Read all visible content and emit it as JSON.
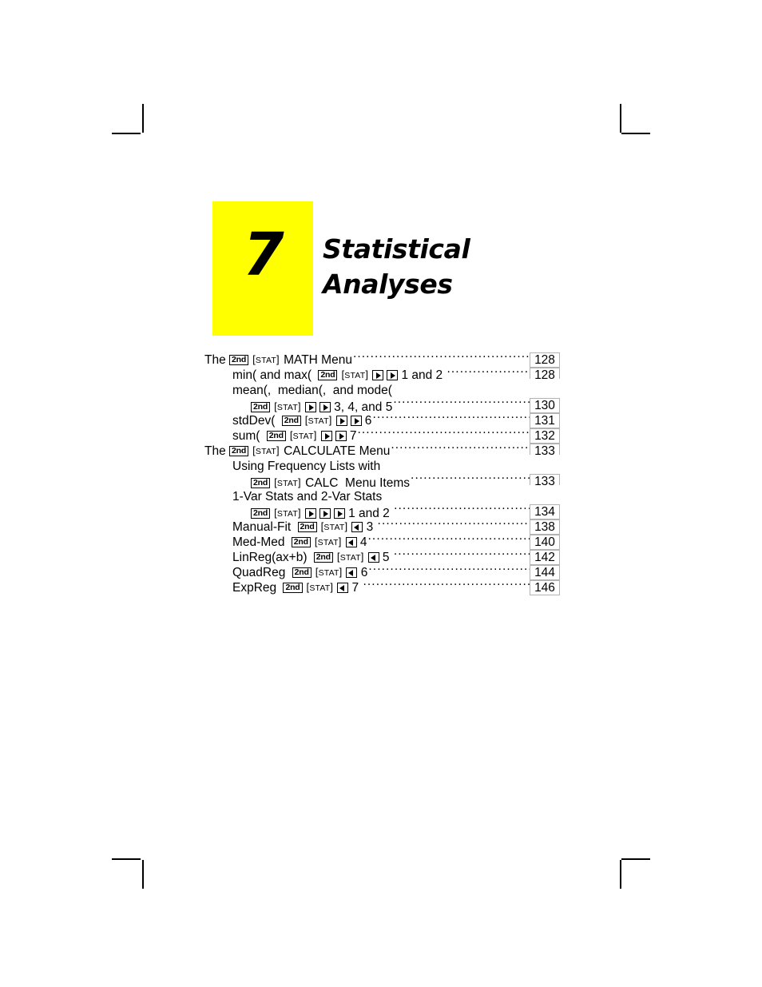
{
  "chapter": {
    "number": "7",
    "title_lines": [
      "Statistical",
      "Analyses"
    ],
    "accent_color": "#ffff00"
  },
  "toc": {
    "rows": [
      {
        "level": 1,
        "page": "128",
        "parts": [
          {
            "t": "text",
            "v": "The "
          },
          {
            "t": "key2nd",
            "v": "2nd"
          },
          {
            "t": "sp"
          },
          {
            "t": "keybrk",
            "v": "STAT"
          },
          {
            "t": "text",
            "v": " MATH Menu"
          }
        ]
      },
      {
        "level": 2,
        "page": "128",
        "parts": [
          {
            "t": "text",
            "v": "min( and max( "
          },
          {
            "t": "sp"
          },
          {
            "t": "key2nd",
            "v": "2nd"
          },
          {
            "t": "sp"
          },
          {
            "t": "keybrk",
            "v": "STAT"
          },
          {
            "t": "sp"
          },
          {
            "t": "keyright"
          },
          {
            "t": "sp"
          },
          {
            "t": "keyright"
          },
          {
            "t": "text",
            "v": " 1 and 2 "
          }
        ]
      },
      {
        "level": 2,
        "page": "",
        "nopage": true,
        "parts": [
          {
            "t": "text",
            "v": "mean(,  median(,  and mode("
          }
        ]
      },
      {
        "level": 3,
        "page": "130",
        "parts": [
          {
            "t": "key2nd",
            "v": "2nd"
          },
          {
            "t": "sp"
          },
          {
            "t": "keybrk",
            "v": "STAT"
          },
          {
            "t": "sp"
          },
          {
            "t": "keyright"
          },
          {
            "t": "sp"
          },
          {
            "t": "keyright"
          },
          {
            "t": "text",
            "v": " 3, 4, and 5"
          }
        ]
      },
      {
        "level": 2,
        "page": "131",
        "parts": [
          {
            "t": "text",
            "v": "stdDev( "
          },
          {
            "t": "sp"
          },
          {
            "t": "key2nd",
            "v": "2nd"
          },
          {
            "t": "sp"
          },
          {
            "t": "keybrk",
            "v": "STAT"
          },
          {
            "t": "sp"
          },
          {
            "t": "keyright"
          },
          {
            "t": "sp"
          },
          {
            "t": "keyright"
          },
          {
            "t": "text",
            "v": " 6"
          }
        ]
      },
      {
        "level": 2,
        "page": "132",
        "parts": [
          {
            "t": "text",
            "v": "sum( "
          },
          {
            "t": "sp"
          },
          {
            "t": "key2nd",
            "v": "2nd"
          },
          {
            "t": "sp"
          },
          {
            "t": "keybrk",
            "v": "STAT"
          },
          {
            "t": "sp"
          },
          {
            "t": "keyright"
          },
          {
            "t": "sp"
          },
          {
            "t": "keyright"
          },
          {
            "t": "text",
            "v": " 7"
          }
        ]
      },
      {
        "level": 1,
        "page": "133",
        "parts": [
          {
            "t": "text",
            "v": "The "
          },
          {
            "t": "key2nd",
            "v": "2nd"
          },
          {
            "t": "sp"
          },
          {
            "t": "keybrk",
            "v": "STAT"
          },
          {
            "t": "text",
            "v": " CALCULATE Menu"
          }
        ]
      },
      {
        "level": 2,
        "page": "",
        "nopage": true,
        "parts": [
          {
            "t": "text",
            "v": "Using Frequency Lists with"
          }
        ]
      },
      {
        "level": 3,
        "page": "133",
        "parts": [
          {
            "t": "key2nd",
            "v": "2nd"
          },
          {
            "t": "sp"
          },
          {
            "t": "keybrk",
            "v": "STAT"
          },
          {
            "t": "text",
            "v": " CALC  Menu Items"
          }
        ]
      },
      {
        "level": 2,
        "page": "",
        "nopage": true,
        "parts": [
          {
            "t": "text",
            "v": "1-Var Stats and 2-Var Stats"
          }
        ]
      },
      {
        "level": 3,
        "page": "134",
        "parts": [
          {
            "t": "key2nd",
            "v": "2nd"
          },
          {
            "t": "sp"
          },
          {
            "t": "keybrk",
            "v": "STAT"
          },
          {
            "t": "sp"
          },
          {
            "t": "keyright"
          },
          {
            "t": "sp"
          },
          {
            "t": "keyright"
          },
          {
            "t": "sp"
          },
          {
            "t": "keyright"
          },
          {
            "t": "text",
            "v": " 1 and 2 "
          }
        ]
      },
      {
        "level": 2,
        "page": "138",
        "parts": [
          {
            "t": "text",
            "v": "Manual-Fit "
          },
          {
            "t": "sp"
          },
          {
            "t": "key2nd",
            "v": "2nd"
          },
          {
            "t": "sp"
          },
          {
            "t": "keybrk",
            "v": "STAT"
          },
          {
            "t": "sp"
          },
          {
            "t": "keyleft"
          },
          {
            "t": "text",
            "v": " 3 "
          }
        ]
      },
      {
        "level": 2,
        "page": "140",
        "parts": [
          {
            "t": "text",
            "v": "Med-Med "
          },
          {
            "t": "sp"
          },
          {
            "t": "key2nd",
            "v": "2nd"
          },
          {
            "t": "sp"
          },
          {
            "t": "keybrk",
            "v": "STAT"
          },
          {
            "t": "sp"
          },
          {
            "t": "keyleft"
          },
          {
            "t": "text",
            "v": " 4"
          }
        ]
      },
      {
        "level": 2,
        "page": "142",
        "parts": [
          {
            "t": "text",
            "v": "LinReg(ax+b) "
          },
          {
            "t": "sp"
          },
          {
            "t": "key2nd",
            "v": "2nd"
          },
          {
            "t": "sp"
          },
          {
            "t": "keybrk",
            "v": "STAT"
          },
          {
            "t": "sp"
          },
          {
            "t": "keyleft"
          },
          {
            "t": "text",
            "v": " 5 "
          }
        ]
      },
      {
        "level": 2,
        "page": "144",
        "parts": [
          {
            "t": "text",
            "v": "QuadReg "
          },
          {
            "t": "sp"
          },
          {
            "t": "key2nd",
            "v": "2nd"
          },
          {
            "t": "sp"
          },
          {
            "t": "keybrk",
            "v": "STAT"
          },
          {
            "t": "sp"
          },
          {
            "t": "keyleft"
          },
          {
            "t": "text",
            "v": " 6"
          }
        ]
      },
      {
        "level": 2,
        "page": "146",
        "parts": [
          {
            "t": "text",
            "v": "ExpReg "
          },
          {
            "t": "sp"
          },
          {
            "t": "key2nd",
            "v": "2nd"
          },
          {
            "t": "sp"
          },
          {
            "t": "keybrk",
            "v": "STAT"
          },
          {
            "t": "sp"
          },
          {
            "t": "keyleft"
          },
          {
            "t": "text",
            "v": " 7 "
          }
        ]
      }
    ]
  }
}
